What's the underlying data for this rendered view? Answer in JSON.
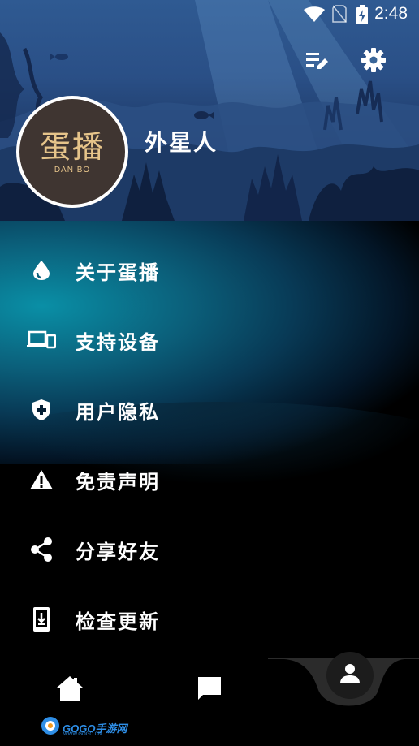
{
  "status_bar": {
    "time": "2:48",
    "wifi_icon": "wifi-icon",
    "sim_icon": "no-sim-icon",
    "battery_icon": "battery-charging-icon"
  },
  "header": {
    "actions": [
      {
        "icon": "playlist-edit-icon"
      },
      {
        "icon": "settings-gear-icon"
      }
    ],
    "avatar": {
      "logo_cn": "蛋播",
      "logo_en": "DAN BO"
    },
    "username": "外星人"
  },
  "menu": {
    "items": [
      {
        "icon": "drop-icon",
        "label": "关于蛋播"
      },
      {
        "icon": "devices-icon",
        "label": "支持设备"
      },
      {
        "icon": "shield-icon",
        "label": "用户隐私"
      },
      {
        "icon": "warning-icon",
        "label": "免责声明"
      },
      {
        "icon": "share-icon",
        "label": "分享好友"
      },
      {
        "icon": "phone-download-icon",
        "label": "检查更新"
      }
    ]
  },
  "bottom_nav": {
    "items": [
      {
        "icon": "home-icon"
      },
      {
        "icon": "chat-icon"
      },
      {
        "icon": "person-icon",
        "active": true
      }
    ]
  },
  "watermark": {
    "text": "GOGO手游网",
    "sub": "WWW.GOGO.CN"
  },
  "colors": {
    "header_top": "#2f5a92",
    "teal_glow": "#0a8fa6",
    "text": "#ffffff",
    "avatar_bg": "#3f3531",
    "avatar_logo": "#e6c48a"
  }
}
